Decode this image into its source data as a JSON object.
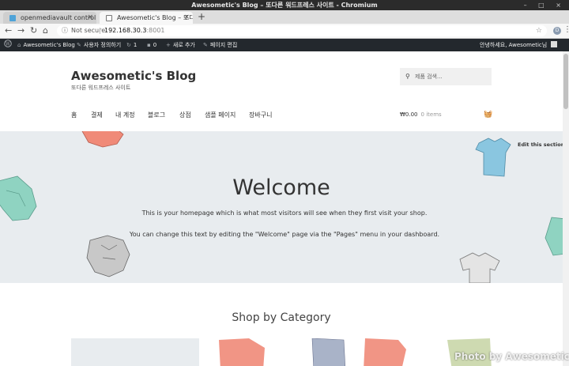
{
  "window": {
    "title": "Awesometic's Blog – 또다른 워드프레스 사이트 - Chromium",
    "controls": "– □ ×"
  },
  "tabs": [
    {
      "label": "openmediavault control p",
      "active": false
    },
    {
      "label": "Awesometic's Blog – 또다",
      "active": true
    }
  ],
  "toolbar": {
    "back": "←",
    "forward": "→",
    "reload": "↻",
    "home": "⌂",
    "security": "Not secure",
    "url_host": "192.168.30.3",
    "url_port": ":8001",
    "profile": "D"
  },
  "wp_admin_bar": {
    "site_name": "Awesometic's Blog",
    "customize": "사용자 정의하기",
    "updates_count": "1",
    "comments_count": "0",
    "new": "새로 추가",
    "edit_page": "페이지 편집",
    "greeting": "안녕하세요, Awesometic님"
  },
  "site": {
    "title": "Awesometic's Blog",
    "tagline": "또다른 워드프레스 사이트",
    "search_placeholder": "제품 검색..."
  },
  "nav": [
    "홈",
    "결제",
    "내 계정",
    "블로그",
    "상점",
    "샘플 페이지",
    "장바구니"
  ],
  "cart": {
    "amount": "₩0.00",
    "items": "0 items"
  },
  "hero": {
    "edit_link": "Edit this section",
    "heading": "Welcome",
    "line1": "This is your homepage which is what most visitors will see when they first visit your shop.",
    "line2": "You can change this text by editing the \"Welcome\" page via the \"Pages\" menu in your dashboard."
  },
  "shop": {
    "heading": "Shop by Category"
  },
  "watermark": "Photo by Awesometic",
  "colors": {
    "wp_bar": "#23282d",
    "hero_bg": "#e8ecef",
    "shirt_teal": "#8fd3c1",
    "shirt_blue": "#8ac6e0",
    "shirt_salmon": "#f08a78",
    "shirt_gray": "#c8c8c8"
  }
}
